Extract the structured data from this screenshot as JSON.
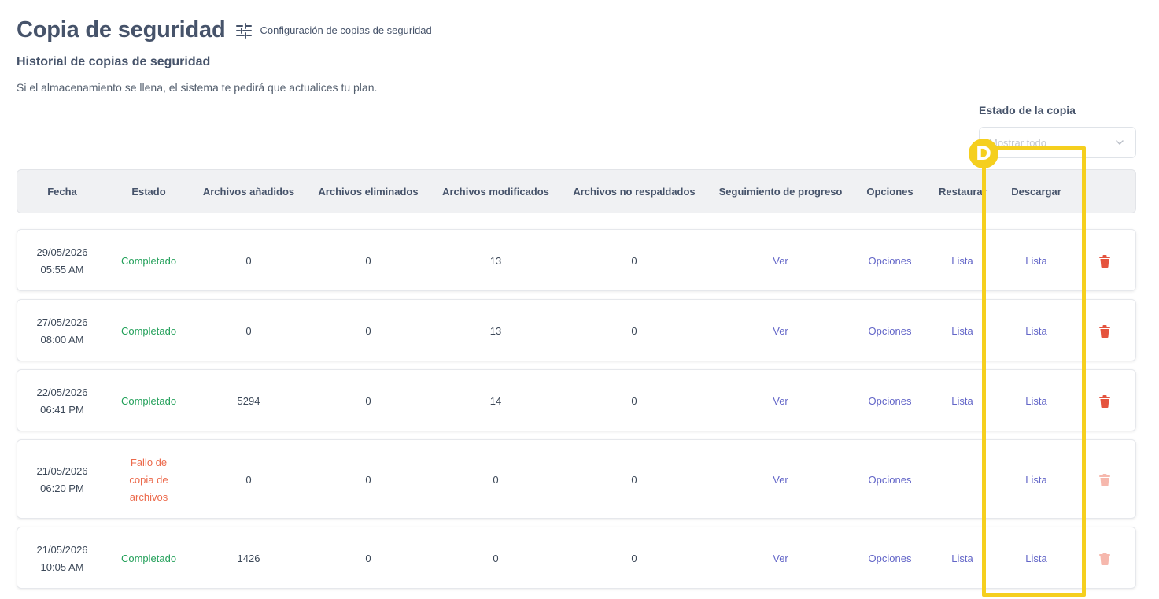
{
  "page": {
    "title": "Copia de seguridad",
    "settings_link": "Configuración de copias de seguridad",
    "subtitle": "Historial de copias de seguridad",
    "description": "Si el almacenamiento se llena, el sistema te pedirá que actualices tu plan."
  },
  "filter": {
    "label": "Estado de la copia",
    "placeholder": "Mostrar todo"
  },
  "table": {
    "headers": {
      "fecha": "Fecha",
      "estado": "Estado",
      "anadidos": "Archivos añadidos",
      "eliminados": "Archivos eliminados",
      "modificados": "Archivos modificados",
      "no_respaldados": "Archivos no respaldados",
      "seguimiento": "Seguimiento de progreso",
      "opciones": "Opciones",
      "restaurar": "Restaurar",
      "descargar": "Descargar"
    },
    "rows": [
      {
        "date": "29/05/2026",
        "time": "05:55 AM",
        "status": "Completado",
        "status_type": "ok",
        "added": "0",
        "deleted": "0",
        "modified": "13",
        "not_backed": "0",
        "progress": "Ver",
        "options": "Opciones",
        "restore": "Lista",
        "download": "Lista",
        "delete_enabled": true
      },
      {
        "date": "27/05/2026",
        "time": "08:00 AM",
        "status": "Completado",
        "status_type": "ok",
        "added": "0",
        "deleted": "0",
        "modified": "13",
        "not_backed": "0",
        "progress": "Ver",
        "options": "Opciones",
        "restore": "Lista",
        "download": "Lista",
        "delete_enabled": true
      },
      {
        "date": "22/05/2026",
        "time": "06:41 PM",
        "status": "Completado",
        "status_type": "ok",
        "added": "5294",
        "deleted": "0",
        "modified": "14",
        "not_backed": "0",
        "progress": "Ver",
        "options": "Opciones",
        "restore": "Lista",
        "download": "Lista",
        "delete_enabled": true
      },
      {
        "date": "21/05/2026",
        "time": "06:20 PM",
        "status": "Fallo de copia de archivos",
        "status_type": "fail",
        "added": "0",
        "deleted": "0",
        "modified": "0",
        "not_backed": "0",
        "progress": "Ver",
        "options": "Opciones",
        "restore": "",
        "download": "Lista",
        "delete_enabled": false
      },
      {
        "date": "21/05/2026",
        "time": "10:05 AM",
        "status": "Completado",
        "status_type": "ok",
        "added": "1426",
        "deleted": "0",
        "modified": "0",
        "not_backed": "0",
        "progress": "Ver",
        "options": "Opciones",
        "restore": "Lista",
        "download": "Lista",
        "delete_enabled": false
      }
    ]
  },
  "annotation": {
    "badge_letter": "D",
    "color": "#f5cf1e"
  },
  "colors": {
    "success": "#23a05a",
    "failure": "#ec6a4c",
    "link": "#6366c8",
    "delete": "#e5533d",
    "delete_disabled": "#f6b8ad"
  },
  "icons": {
    "settings": "sliders-icon",
    "filter_dropdown": "chevron-down-icon",
    "delete": "trash-icon"
  }
}
